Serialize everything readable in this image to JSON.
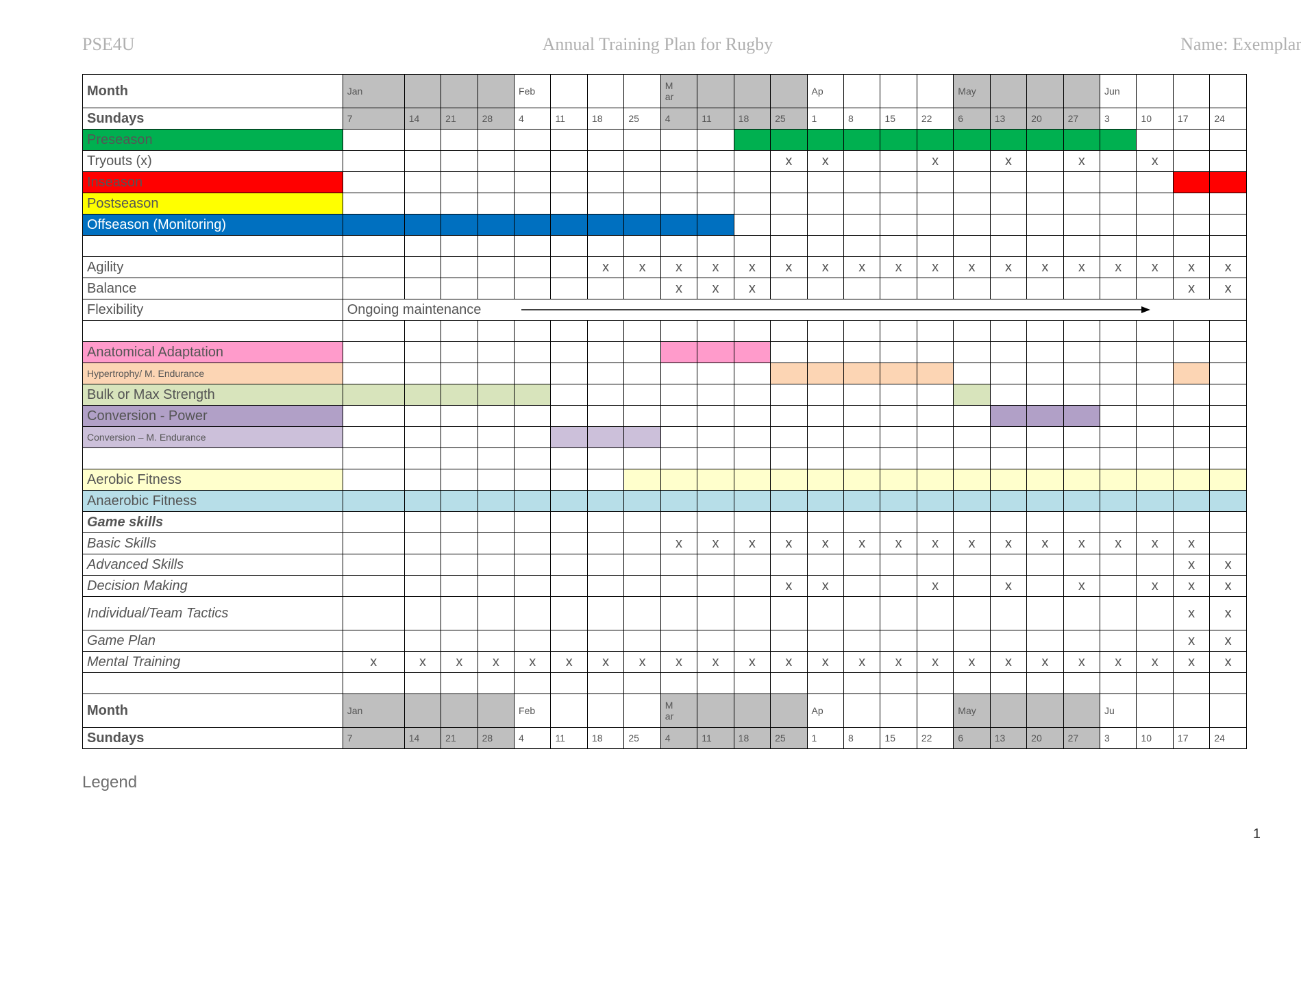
{
  "header": {
    "left": "PSE4U",
    "center": "Annual Training Plan for Rugby",
    "right": "Name: Exemplar"
  },
  "labels": {
    "month": "Month",
    "sundays": "Sundays",
    "preseason": "Preseason",
    "tryouts": "Tryouts (x)",
    "inseason": "Inseason",
    "postseason": "Postseason",
    "offseason": "Offseason (Monitoring)",
    "agility": "Agility",
    "balance": "Balance",
    "flexibility": "Flexibility",
    "flex_text": "Ongoing maintenance",
    "anat": "Anatomical Adaptation",
    "hyper": "Hypertrophy/ M. Endurance",
    "bulk": "Bulk or Max Strength",
    "convp": "Conversion - Power",
    "convm": "Conversion – M. Endurance",
    "aerobic": "Aerobic Fitness",
    "anaerobic": "Anaerobic Fitness",
    "gameskills": "Game skills",
    "basic": "Basic Skills",
    "advanced": "Advanced Skills",
    "decision": "Decision Making",
    "tactics": "Individual/Team Tactics",
    "gameplan": "Game Plan",
    "mental": "Mental Training",
    "legend": "Legend",
    "pagenum": "1"
  },
  "months_top": [
    "Jan",
    "",
    "",
    "",
    "Feb",
    "",
    "",
    "",
    "Mar",
    "",
    "",
    "",
    "Ap",
    "",
    "",
    "",
    "May",
    "",
    "",
    "",
    "Jun",
    "",
    "",
    ""
  ],
  "months_bot": [
    "Jan",
    "",
    "",
    "",
    "Feb",
    "",
    "",
    "",
    "Mar",
    "",
    "",
    "",
    "Ap",
    "",
    "",
    "",
    "May",
    "",
    "",
    "",
    "Ju",
    "",
    "",
    ""
  ],
  "days": [
    "7",
    "14",
    "21",
    "28",
    "4",
    "11",
    "18",
    "25",
    "4",
    "11",
    "18",
    "25",
    "1",
    "8",
    "15",
    "22",
    "6",
    "13",
    "20",
    "27",
    "3",
    "10",
    "17",
    "24"
  ],
  "month_shade": [
    true,
    true,
    true,
    true,
    false,
    false,
    false,
    false,
    true,
    true,
    true,
    true,
    false,
    false,
    false,
    false,
    true,
    true,
    true,
    true,
    false,
    false,
    false,
    false
  ],
  "rows": {
    "preseason": {
      "color": "green",
      "fill": [
        0,
        0,
        0,
        0,
        0,
        0,
        0,
        0,
        0,
        0,
        1,
        1,
        1,
        1,
        1,
        1,
        1,
        1,
        1,
        1,
        1,
        0,
        0,
        0
      ]
    },
    "tryouts": {
      "x": [
        0,
        0,
        0,
        0,
        0,
        0,
        0,
        0,
        0,
        0,
        0,
        1,
        1,
        0,
        0,
        1,
        0,
        1,
        0,
        1,
        0,
        1,
        0,
        0
      ]
    },
    "inseason": {
      "color": "red",
      "fill": [
        0,
        0,
        0,
        0,
        0,
        0,
        0,
        0,
        0,
        0,
        0,
        0,
        0,
        0,
        0,
        0,
        0,
        0,
        0,
        0,
        0,
        0,
        1,
        1
      ]
    },
    "offseason": {
      "color": "blue",
      "fill": [
        1,
        1,
        1,
        1,
        1,
        1,
        1,
        1,
        1,
        1,
        0,
        0,
        0,
        0,
        0,
        0,
        0,
        0,
        0,
        0,
        0,
        0,
        0,
        0
      ]
    },
    "agility": {
      "x": [
        0,
        0,
        0,
        0,
        0,
        0,
        1,
        1,
        1,
        1,
        1,
        1,
        1,
        1,
        1,
        1,
        1,
        1,
        1,
        1,
        1,
        1,
        1,
        1
      ]
    },
    "balance": {
      "x": [
        0,
        0,
        0,
        0,
        0,
        0,
        0,
        0,
        1,
        1,
        1,
        0,
        0,
        0,
        0,
        0,
        0,
        0,
        0,
        0,
        0,
        0,
        1,
        1
      ]
    },
    "anat": {
      "color": "pink",
      "fill": [
        0,
        0,
        0,
        0,
        0,
        0,
        0,
        0,
        1,
        1,
        1,
        0,
        0,
        0,
        0,
        0,
        0,
        0,
        0,
        0,
        0,
        0,
        0,
        0
      ]
    },
    "hyper": {
      "color": "peach",
      "fill": [
        0,
        0,
        0,
        0,
        0,
        0,
        0,
        0,
        0,
        0,
        0,
        1,
        1,
        1,
        1,
        1,
        0,
        0,
        0,
        0,
        0,
        0,
        1,
        0
      ]
    },
    "bulk": {
      "color": "lgreen",
      "fill": [
        1,
        1,
        1,
        1,
        1,
        0,
        0,
        0,
        0,
        0,
        0,
        0,
        0,
        0,
        0,
        0,
        1,
        0,
        0,
        0,
        0,
        0,
        0,
        0
      ]
    },
    "convp": {
      "color": "violet",
      "fill": [
        0,
        0,
        0,
        0,
        0,
        0,
        0,
        0,
        0,
        0,
        0,
        0,
        0,
        0,
        0,
        0,
        0,
        1,
        1,
        1,
        0,
        0,
        0,
        0
      ]
    },
    "convm": {
      "color": "mpurple",
      "fill": [
        0,
        0,
        0,
        0,
        0,
        1,
        1,
        1,
        0,
        0,
        0,
        0,
        0,
        0,
        0,
        0,
        0,
        0,
        0,
        0,
        0,
        0,
        0,
        0
      ]
    },
    "aerobic": {
      "color": "cream",
      "fill": [
        0,
        0,
        0,
        0,
        0,
        0,
        0,
        1,
        1,
        1,
        1,
        1,
        1,
        1,
        1,
        1,
        1,
        1,
        1,
        1,
        1,
        1,
        1,
        1
      ]
    },
    "anaerobic": {
      "color": "lblue",
      "fill": [
        1,
        1,
        1,
        1,
        1,
        1,
        1,
        1,
        1,
        1,
        1,
        1,
        1,
        1,
        1,
        1,
        1,
        1,
        1,
        1,
        1,
        1,
        1,
        1
      ]
    },
    "basic": {
      "x": [
        0,
        0,
        0,
        0,
        0,
        0,
        0,
        0,
        1,
        1,
        1,
        1,
        1,
        1,
        1,
        1,
        1,
        1,
        1,
        1,
        1,
        1,
        1,
        0
      ]
    },
    "advanced": {
      "x": [
        0,
        0,
        0,
        0,
        0,
        0,
        0,
        0,
        0,
        0,
        0,
        0,
        0,
        0,
        0,
        0,
        0,
        0,
        0,
        0,
        0,
        0,
        1,
        1
      ]
    },
    "decision": {
      "x": [
        0,
        0,
        0,
        0,
        0,
        0,
        0,
        0,
        0,
        0,
        0,
        1,
        1,
        0,
        0,
        1,
        0,
        1,
        0,
        1,
        0,
        1,
        1,
        1
      ]
    },
    "tactics": {
      "x": [
        0,
        0,
        0,
        0,
        0,
        0,
        0,
        0,
        0,
        0,
        0,
        0,
        0,
        0,
        0,
        0,
        0,
        0,
        0,
        0,
        0,
        0,
        1,
        1
      ]
    },
    "gameplan": {
      "x": [
        0,
        0,
        0,
        0,
        0,
        0,
        0,
        0,
        0,
        0,
        0,
        0,
        0,
        0,
        0,
        0,
        0,
        0,
        0,
        0,
        0,
        0,
        1,
        1
      ]
    },
    "mental": {
      "x": [
        1,
        1,
        1,
        1,
        1,
        1,
        1,
        1,
        1,
        1,
        1,
        1,
        1,
        1,
        1,
        1,
        1,
        1,
        1,
        1,
        1,
        1,
        1,
        1
      ]
    }
  }
}
